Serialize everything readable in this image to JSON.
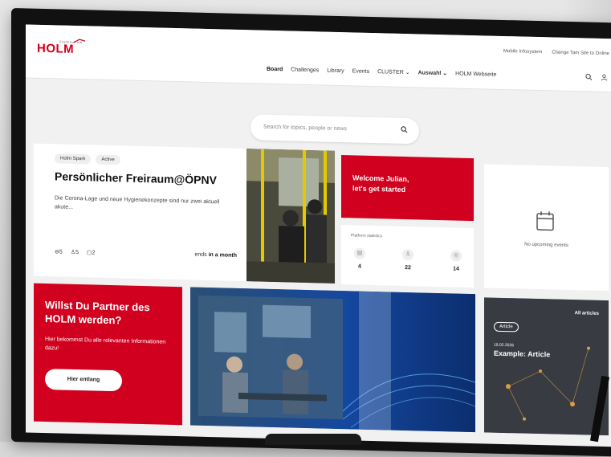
{
  "logo": {
    "subtitle": "Frankfurt am",
    "text": "HOLM"
  },
  "utility_links": [
    "Mobile Infosystem",
    "Change Tam Site to Online"
  ],
  "nav": {
    "items": [
      "Board",
      "Challenges",
      "Library",
      "Events",
      "CLUSTER ⌄",
      "Auswahl ⌄",
      "HOLM Webseite"
    ],
    "active": "Board"
  },
  "search": {
    "placeholder": "Search for topics, people or news"
  },
  "spark": {
    "tags": [
      "Holm Spark",
      "Active"
    ],
    "title": "Persönlicher Freiraum@ÖPNV",
    "description": "Die Corona-Lage und neue Hygienekonzepte sind nur zwei aktuell akute...",
    "stats": {
      "ideas": "5",
      "people": "5",
      "comments": "2"
    },
    "ends_prefix": "ends",
    "ends_value": "in a month"
  },
  "welcome": {
    "line1": "Welcome Julian,",
    "line2": "let's get started"
  },
  "platform": {
    "label": "Platform statistics",
    "values": [
      "4",
      "22",
      "14"
    ]
  },
  "events": {
    "empty_text": "No upcoming events"
  },
  "partner": {
    "title": "Willst Du Partner des HOLM werden?",
    "text": "Hier bekommst Du alle relevanten Informationen dazu!",
    "button": "Hier entlang"
  },
  "article": {
    "all_label": "All articles",
    "badge": "Article",
    "date": "19.02.2026",
    "title": "Example: Article"
  },
  "colors": {
    "brand": "#d0001e"
  }
}
